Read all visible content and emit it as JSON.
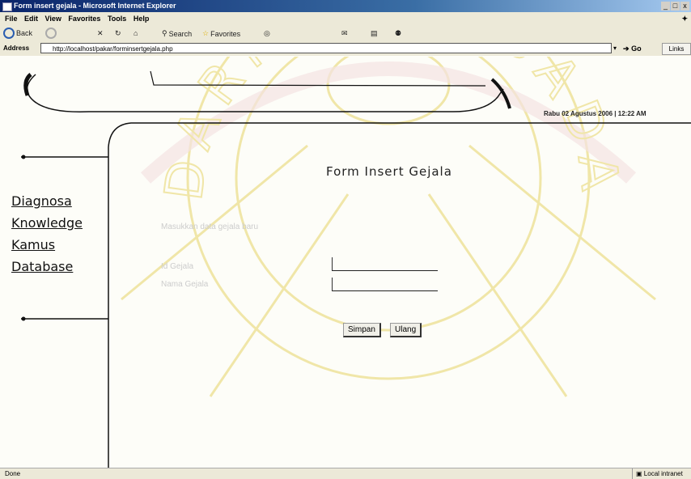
{
  "window": {
    "title": "Form insert gejala - Microsoft Internet Explorer",
    "buttons": [
      "_",
      "□",
      "x"
    ]
  },
  "menu": [
    "File",
    "Edit",
    "View",
    "Favorites",
    "Tools",
    "Help"
  ],
  "toolbar": {
    "back_label": "Back",
    "search_label": "Search",
    "favorites_label": "Favorites"
  },
  "address": {
    "label": "Address",
    "url": "http://localhost/pakar/forminsertgejala.php",
    "go_label": "Go",
    "links_label": "Links"
  },
  "header": {
    "date": "Rabu 02 Agustus 2006 | 12:22 AM"
  },
  "sidebar": {
    "items": [
      {
        "label": "Diagnosa"
      },
      {
        "label": "Knowledge"
      },
      {
        "label": "Kamus"
      },
      {
        "label": "Database"
      }
    ]
  },
  "form": {
    "title": "Form Insert Gejala",
    "instruction": "Masukkan data gejala baru",
    "fields": [
      {
        "label": "Id Gejala",
        "value": ""
      },
      {
        "label": "Nama Gejala",
        "value": ""
      }
    ],
    "save_label": "Simpan",
    "reset_label": "Ulang"
  },
  "watermark": {
    "text": "DARMA PERSADA"
  },
  "status": {
    "text": "Done",
    "zone": "Local intranet"
  }
}
